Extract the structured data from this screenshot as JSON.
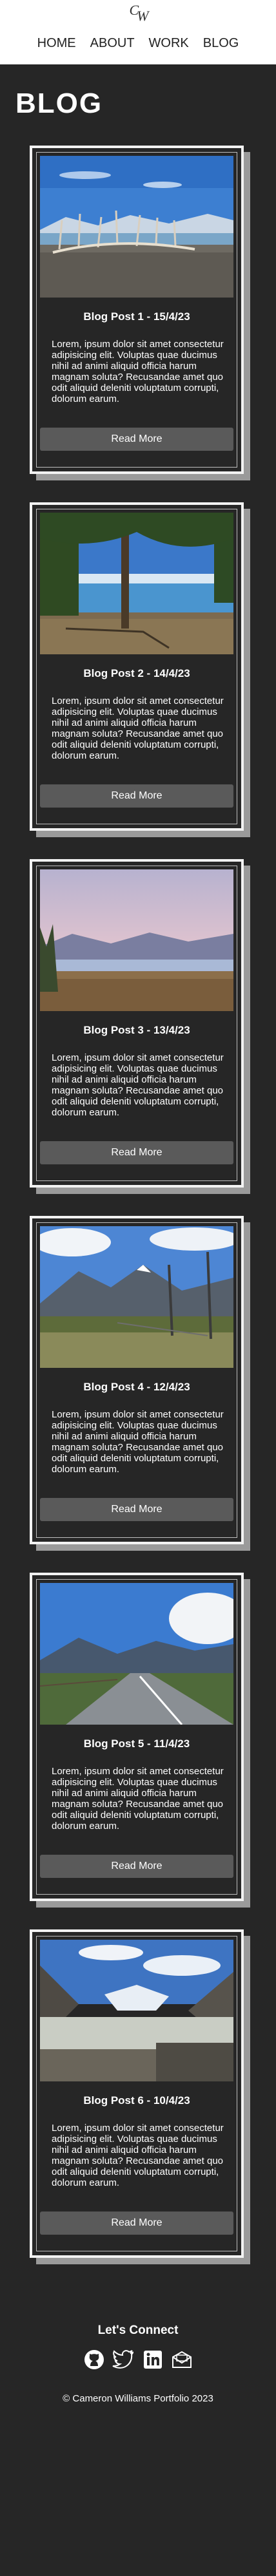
{
  "header": {
    "logo_text": "CW",
    "nav": [
      "HOME",
      "ABOUT",
      "WORK",
      "BLOG"
    ]
  },
  "page_title": "BLOG",
  "posts": [
    {
      "title": "Blog Post 1 - 15/4/23",
      "body": "Lorem, ipsum dolor sit amet consectetur adipisicing elit. Voluptas quae ducimus nihil ad animi aliquid officia harum magnam soluta? Recusandae amet quo odit aliquid deleniti voluptatum corrupti, dolorum earum.",
      "button": "Read More"
    },
    {
      "title": "Blog Post 2 - 14/4/23",
      "body": "Lorem, ipsum dolor sit amet consectetur adipisicing elit. Voluptas quae ducimus nihil ad animi aliquid officia harum magnam soluta? Recusandae amet quo odit aliquid deleniti voluptatum corrupti, dolorum earum.",
      "button": "Read More"
    },
    {
      "title": "Blog Post 3 - 13/4/23",
      "body": "Lorem, ipsum dolor sit amet consectetur adipisicing elit. Voluptas quae ducimus nihil ad animi aliquid officia harum magnam soluta? Recusandae amet quo odit aliquid deleniti voluptatum corrupti, dolorum earum.",
      "button": "Read More"
    },
    {
      "title": "Blog Post 4 - 12/4/23",
      "body": "Lorem, ipsum dolor sit amet consectetur adipisicing elit. Voluptas quae ducimus nihil ad animi aliquid officia harum magnam soluta? Recusandae amet quo odit aliquid deleniti voluptatum corrupti, dolorum earum.",
      "button": "Read More"
    },
    {
      "title": "Blog Post 5 - 11/4/23",
      "body": "Lorem, ipsum dolor sit amet consectetur adipisicing elit. Voluptas quae ducimus nihil ad animi aliquid officia harum magnam soluta? Recusandae amet quo odit aliquid deleniti voluptatum corrupti, dolorum earum.",
      "button": "Read More"
    },
    {
      "title": "Blog Post 6 - 10/4/23",
      "body": "Lorem, ipsum dolor sit amet consectetur adipisicing elit. Voluptas quae ducimus nihil ad animi aliquid officia harum magnam soluta? Recusandae amet quo odit aliquid deleniti voluptatum corrupti, dolorum earum.",
      "button": "Read More"
    }
  ],
  "footer": {
    "connect_title": "Let's Connect",
    "socials": [
      "github-icon",
      "twitter-icon",
      "linkedin-icon",
      "mail-icon"
    ],
    "copyright": "© Cameron Williams Portfolio 2023"
  },
  "colors": {
    "background": "#262626",
    "header": "#ffffff",
    "button": "#5a5a5a",
    "card_border": "#f2f2f2"
  }
}
